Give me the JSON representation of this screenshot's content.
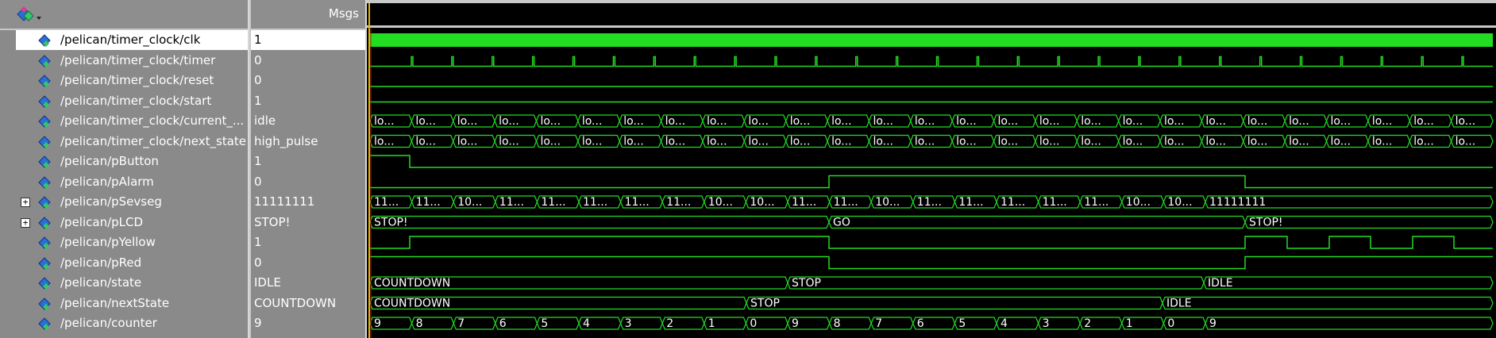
{
  "toolbar": {
    "logo_icon": "wave-window-icon",
    "dropdown_icon": "chevron-down-icon"
  },
  "header": {
    "msgs_label": "Msgs"
  },
  "colors": {
    "wave": "#22dd22",
    "background": "#000000",
    "cursor": "#e8b400",
    "panel": "#8a8a8a"
  },
  "signals": [
    {
      "name": "/pelican/timer_clock/clk",
      "value": "1",
      "type": "bit",
      "selected": true,
      "expandable": false
    },
    {
      "name": "/pelican/timer_clock/timer",
      "value": "0",
      "type": "bit",
      "selected": false,
      "expandable": false
    },
    {
      "name": "/pelican/timer_clock/reset",
      "value": "0",
      "type": "bit",
      "selected": false,
      "expandable": false
    },
    {
      "name": "/pelican/timer_clock/start",
      "value": "1",
      "type": "bit",
      "selected": false,
      "expandable": false
    },
    {
      "name": "/pelican/timer_clock/current_...",
      "value": "idle",
      "type": "bus",
      "selected": false,
      "expandable": false
    },
    {
      "name": "/pelican/timer_clock/next_state",
      "value": "high_pulse",
      "type": "bus",
      "selected": false,
      "expandable": false
    },
    {
      "name": "/pelican/pButton",
      "value": "1",
      "type": "bit",
      "selected": false,
      "expandable": false
    },
    {
      "name": "/pelican/pAlarm",
      "value": "0",
      "type": "bit",
      "selected": false,
      "expandable": false
    },
    {
      "name": "/pelican/pSevseg",
      "value": "11111111",
      "type": "bus",
      "selected": false,
      "expandable": true
    },
    {
      "name": "/pelican/pLCD",
      "value": "STOP!",
      "type": "bus",
      "selected": false,
      "expandable": true
    },
    {
      "name": "/pelican/pYellow",
      "value": "1",
      "type": "bit",
      "selected": false,
      "expandable": false
    },
    {
      "name": "/pelican/pRed",
      "value": "0",
      "type": "bit",
      "selected": false,
      "expandable": false
    },
    {
      "name": "/pelican/state",
      "value": "IDLE",
      "type": "bus",
      "selected": false,
      "expandable": false
    },
    {
      "name": "/pelican/nextState",
      "value": "COUNTDOWN",
      "type": "bus",
      "selected": false,
      "expandable": false
    },
    {
      "name": "/pelican/counter",
      "value": "9",
      "type": "bus",
      "selected": false,
      "expandable": false
    }
  ],
  "waves": {
    "state_abbrev": "lo...",
    "sevseg_segments": [
      "11...",
      "11...",
      "10...",
      "11...",
      "11...",
      "11...",
      "11...",
      "11...",
      "10...",
      "10...",
      "11...",
      "11...",
      "10...",
      "11...",
      "11...",
      "11...",
      "11...",
      "11...",
      "10...",
      "10...",
      "11111111"
    ],
    "lcd_segments": [
      "STOP!",
      "GO",
      "STOP!"
    ],
    "state_segments": [
      "COUNTDOWN",
      "STOP",
      "IDLE"
    ],
    "nextstate_segments": [
      "COUNTDOWN",
      "STOP",
      "IDLE"
    ],
    "counter_segments": [
      "9",
      "8",
      "7",
      "6",
      "5",
      "4",
      "3",
      "2",
      "1",
      "0",
      "9",
      "8",
      "7",
      "6",
      "5",
      "4",
      "3",
      "2",
      "1",
      "0",
      "9"
    ]
  }
}
